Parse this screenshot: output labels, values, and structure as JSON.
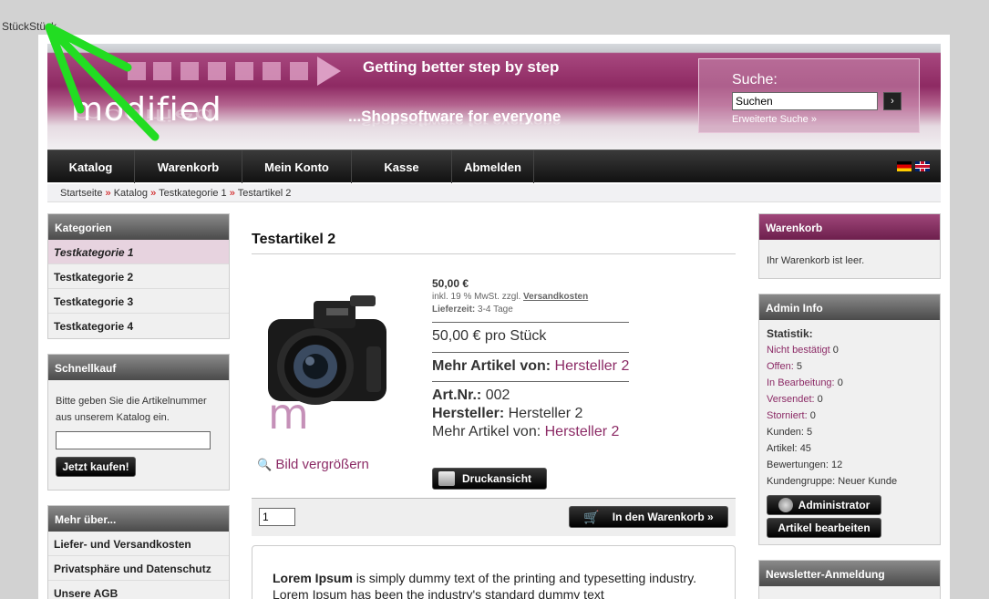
{
  "debug_text": "StückStück",
  "header": {
    "logo": "modified",
    "tagline1": "Getting better step by step",
    "tagline2": "...Shopsoftware for everyone",
    "search_label": "Suche:",
    "search_value": "Suchen",
    "search_button": "›",
    "advanced_search": "Erweiterte Suche »"
  },
  "nav": [
    "Katalog",
    "Warenkorb",
    "Mein Konto",
    "Kasse",
    "Abmelden"
  ],
  "breadcrumb": [
    "Startseite",
    "Katalog",
    "Testkategorie 1",
    "Testartikel 2"
  ],
  "breadcrumb_sep": "»",
  "categories": {
    "title": "Kategorien",
    "items": [
      "Testkategorie 1",
      "Testkategorie 2",
      "Testkategorie 3",
      "Testkategorie 4"
    ]
  },
  "quickbuy": {
    "title": "Schnellkauf",
    "text": "Bitte geben Sie die Artikelnummer aus unserem Katalog ein.",
    "button": "Jetzt kaufen!"
  },
  "more_about": {
    "title": "Mehr über...",
    "items": [
      "Liefer- und Versandkosten",
      "Privatsphäre und Datenschutz",
      "Unsere AGB"
    ]
  },
  "product": {
    "title": "Testartikel 2",
    "price": "50,00 €",
    "tax_prefix": "inkl. 19 % MwSt. zzgl.",
    "tax_link": "Versandkosten",
    "delivery_label": "Lieferzeit:",
    "delivery_value": "3-4 Tage",
    "per_piece": "50,00 € pro Stück",
    "more_label": "Mehr Artikel von:",
    "manufacturer": "Hersteller 2",
    "artnr_label": "Art.Nr.:",
    "artnr_value": "002",
    "manufacturer_label": "Hersteller:",
    "more_label2": "Mehr Artikel von:",
    "zoom": "Bild vergrößern",
    "print_button": "Druckansicht",
    "quantity": "1",
    "cart_button": "In den Warenkorb »",
    "desc_bold": "Lorem Ipsum",
    "desc_rest": " is simply dummy text of the printing and typesetting industry. Lorem Ipsum has been the industry's standard dummy text"
  },
  "cart": {
    "title": "Warenkorb",
    "empty": "Ihr Warenkorb ist leer."
  },
  "admin": {
    "title": "Admin Info",
    "stat_label": "Statistik:",
    "stats": [
      {
        "label": "Nicht bestätigt",
        "value": "0",
        "link": true
      },
      {
        "label": "Offen:",
        "value": "5",
        "link": true
      },
      {
        "label": "In Bearbeitung:",
        "value": "0",
        "link": true
      },
      {
        "label": "Versendet:",
        "value": "0",
        "link": true
      },
      {
        "label": "Storniert:",
        "value": "0",
        "link": true
      },
      {
        "label": "Kunden:",
        "value": "5",
        "link": false
      },
      {
        "label": "Artikel:",
        "value": "45",
        "link": false
      },
      {
        "label": "Bewertungen:",
        "value": "12",
        "link": false
      },
      {
        "label": "Kundengruppe:",
        "value": "Neuer Kunde",
        "link": false
      }
    ],
    "admin_button": "Administrator",
    "edit_button": "Artikel bearbeiten"
  },
  "newsletter": {
    "title": "Newsletter-Anmeldung"
  },
  "colors": {
    "accent": "#8c2b66",
    "arrow": "#22dd22"
  }
}
